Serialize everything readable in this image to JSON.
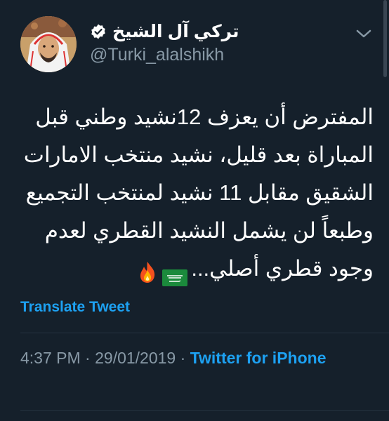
{
  "tweet": {
    "author": {
      "display_name": "تركي آل الشيخ",
      "handle": "@Turki_alalshikh",
      "verified_icon": "verified-badge-icon",
      "menu_icon": "chevron-down-icon"
    },
    "text_lines": [
      "المفترض أن يعزف 12نشيد وطني قبل",
      "المباراة بعد قليل، نشيد منتخب الامارات",
      "الشقيق مقابل 11 نشيد لمنتخب التجميع",
      "وطبعاً لن يشمل النشيد القطري لعدم",
      "وجود قطري أصلي..."
    ],
    "emojis": [
      "saudi-flag",
      "fire"
    ],
    "translate_label": "Translate Tweet",
    "time": "4:37 PM",
    "date": "29/01/2019",
    "separator": "·",
    "source": "Twitter for iPhone"
  },
  "colors": {
    "background": "#15202b",
    "accent": "#1da1f2",
    "secondary_text": "#8899a6",
    "primary_text": "#ffffff"
  }
}
